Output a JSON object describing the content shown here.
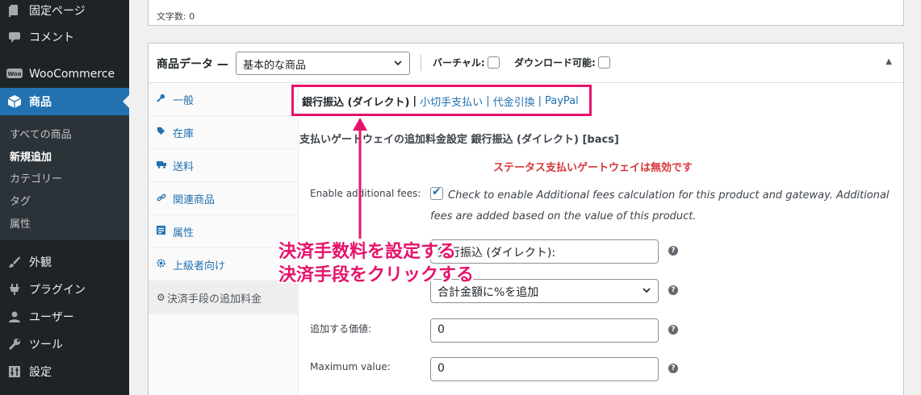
{
  "sidebar": {
    "items": [
      {
        "label": "固定ページ",
        "icon": "page-icon"
      },
      {
        "label": "コメント",
        "icon": "comment-icon"
      },
      {
        "label": "WooCommerce",
        "icon": "woocommerce-icon"
      },
      {
        "label": "商品",
        "icon": "products-icon"
      },
      {
        "label": "外観",
        "icon": "appearance-icon"
      },
      {
        "label": "プラグイン",
        "icon": "plugins-icon"
      },
      {
        "label": "ユーザー",
        "icon": "users-icon"
      },
      {
        "label": "ツール",
        "icon": "tools-icon"
      },
      {
        "label": "設定",
        "icon": "settings-icon"
      }
    ],
    "submenu": [
      "すべての商品",
      "新規追加",
      "カテゴリー",
      "タグ",
      "属性"
    ]
  },
  "editor": {
    "word_count": "文字数: 0"
  },
  "product_data": {
    "title": "商品データ —",
    "type_value": "基本的な商品",
    "virtual_label": "バーチャル:",
    "download_label": "ダウンロード可能:",
    "tabs": [
      "一般",
      "在庫",
      "送料",
      "関連商品",
      "属性",
      "上級者向け",
      "決済手段の追加料金"
    ]
  },
  "gateways": {
    "current": "銀行振込 (ダイレクト)",
    "links": [
      "小切手支払い",
      "代金引換",
      "PayPal"
    ],
    "separator": "|"
  },
  "panel": {
    "section_title": "支払いゲートウェイの追加料金設定 銀行振込 (ダイレクト) [bacs]",
    "status": "ステータス支払いゲートウェイは無効です",
    "enable_label": "Enable additional fees:",
    "enable_desc": "Check to enable Additional fees calculation for this product and gateway. Additional fees are added based on the value of this product.",
    "title_value": "銀行振込 (ダイレクト):",
    "type_value": "合計金額に%を追加",
    "value_label": "追加する価値:",
    "value_value": "0",
    "max_label": "Maximum value:",
    "max_value": "0",
    "help_glyph": "?"
  },
  "annotation": {
    "line1": "決済手数料を設定する",
    "line2": "決済手段をクリックする",
    "color": "#e6136b"
  }
}
